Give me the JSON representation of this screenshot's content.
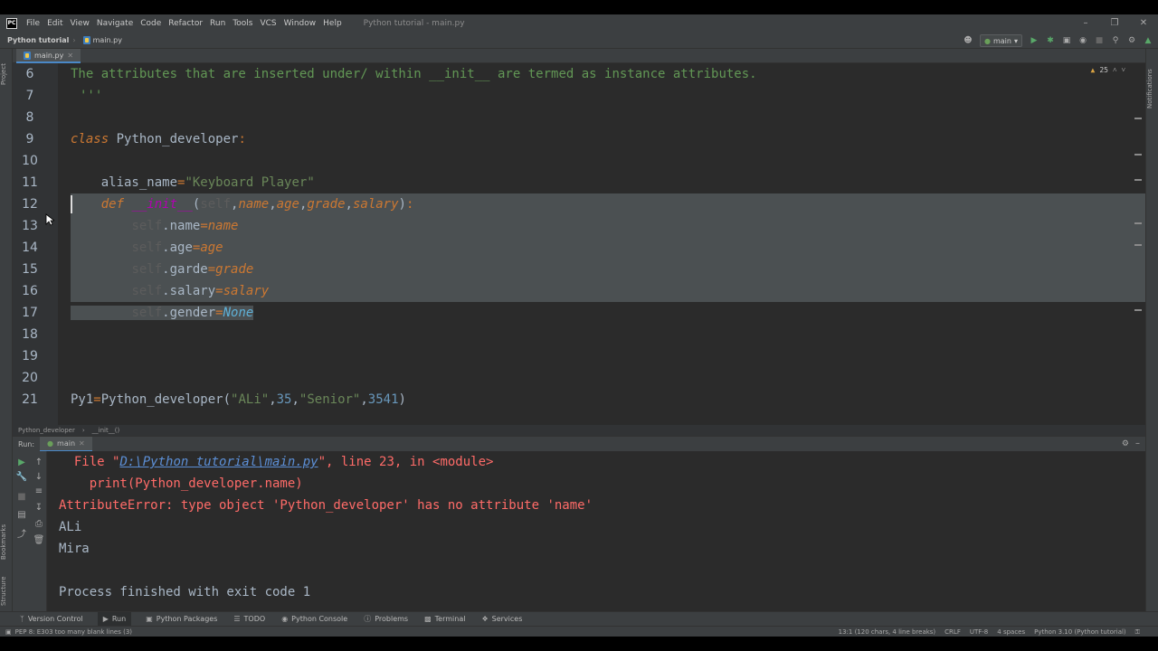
{
  "window": {
    "title": "Python tutorial - main.py",
    "menu": [
      "File",
      "Edit",
      "View",
      "Navigate",
      "Code",
      "Refactor",
      "Run",
      "Tools",
      "VCS",
      "Window",
      "Help"
    ]
  },
  "navbar": {
    "project": "Python tutorial",
    "file": "main.py",
    "run_config": "main"
  },
  "editor": {
    "tab_label": "main.py",
    "warning_count": "25",
    "lines": [
      {
        "n": "6",
        "text": "The attributes that are inserted under/ within __init__ are termed as instance attributes."
      },
      {
        "n": "7",
        "text": "'''"
      },
      {
        "n": "8",
        "text": ""
      },
      {
        "n": "9",
        "text": "class Python_developer:"
      },
      {
        "n": "10",
        "text": ""
      },
      {
        "n": "11",
        "text": "    alias_name=\"Keyboard Player\""
      },
      {
        "n": "12",
        "text": "    def __init__(self,name,age,grade,salary):"
      },
      {
        "n": "13",
        "text": "        self.name=name"
      },
      {
        "n": "14",
        "text": "        self.age=age"
      },
      {
        "n": "15",
        "text": "        self.garde=grade"
      },
      {
        "n": "16",
        "text": "        self.salary=salary"
      },
      {
        "n": "17",
        "text": "        self.gender=None"
      },
      {
        "n": "18",
        "text": ""
      },
      {
        "n": "19",
        "text": ""
      },
      {
        "n": "20",
        "text": ""
      },
      {
        "n": "21",
        "text": "Py1=Python_developer(\"ALi\",35,\"Senior\",3541)"
      }
    ],
    "breadcrumb": [
      "Python_developer",
      "__init__()"
    ]
  },
  "run": {
    "label": "Run:",
    "tab": "main",
    "console": [
      {
        "kind": "trace_prefix",
        "pre": "  File \"",
        "link": "D:\\Python tutorial\\main.py",
        "post": "\", line 23, in <module>"
      },
      {
        "kind": "err",
        "text": "    print(Python_developer.name)"
      },
      {
        "kind": "err",
        "text": "AttributeError: type object 'Python_developer' has no attribute 'name'"
      },
      {
        "kind": "out",
        "text": "ALi"
      },
      {
        "kind": "out",
        "text": "Mira"
      },
      {
        "kind": "out",
        "text": ""
      },
      {
        "kind": "out",
        "text": "Process finished with exit code 1"
      }
    ]
  },
  "tool_windows": [
    "Version Control",
    "Run",
    "Python Packages",
    "TODO",
    "Python Console",
    "Problems",
    "Terminal",
    "Services"
  ],
  "status": {
    "message": "PEP 8: E303 too many blank lines (3)",
    "position": "13:1 (120 chars, 4 line breaks)",
    "line_sep": "CRLF",
    "encoding": "UTF-8",
    "indent": "4 spaces",
    "interpreter": "Python 3.10 (Python tutorial)"
  },
  "side_labels": {
    "project": "Project",
    "bookmarks": "Bookmarks",
    "structure": "Structure",
    "notifications": "Notifications"
  },
  "colors": {
    "background": "#2b2b2b",
    "selection": "#4b5052",
    "error": "#ff6b68",
    "keyword": "#cc7832",
    "string": "#6a8759",
    "number": "#6897bb"
  }
}
